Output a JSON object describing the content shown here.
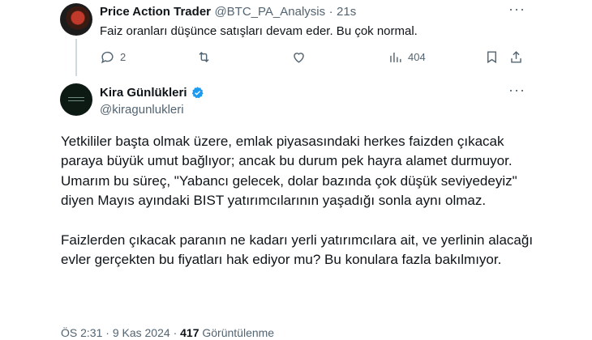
{
  "reply_tweet": {
    "display_name": "Price Action Trader",
    "handle": "@BTC_PA_Analysis",
    "separator": "·",
    "time": "21s",
    "text": "Faiz oranları düşünce satışları devam eder. Bu çok normal.",
    "more_label": "···",
    "actions": {
      "reply_count": "2",
      "retweet_count": "",
      "like_count": "",
      "views_count": "404"
    }
  },
  "main_tweet": {
    "display_name": "Kira Günlükleri",
    "handle": "@kiragunlukleri",
    "verified": true,
    "more_label": "···",
    "paragraph_1": "Yetkililer başta olmak üzere, emlak piyasasındaki herkes faizden çıkacak paraya büyük umut bağlıyor; ancak bu durum pek hayra alamet durmuyor. Umarım bu süreç, \"Yabancı gelecek, dolar bazında çok düşük seviyedeyiz\" diyen Mayıs ayındaki BIST yatırımcılarının yaşadığı sonla aynı olmaz.",
    "paragraph_2": "Faizlerden çıkacak paranın ne kadarı yerli yatırımcılara ait, ve yerlinin alacağı evler gerçekten bu fiyatları hak ediyor mu? Bu konulara fazla bakılmıyor.",
    "meta": {
      "time": "ÖS 2:31",
      "dot": "·",
      "date": "9 Kas 2024",
      "views_count": "417",
      "views_label": "Görüntülenme"
    }
  },
  "colors": {
    "text_primary": "#0f1419",
    "text_secondary": "#536471",
    "verified_blue": "#1d9bf0",
    "thread_line": "#cfd9de"
  }
}
